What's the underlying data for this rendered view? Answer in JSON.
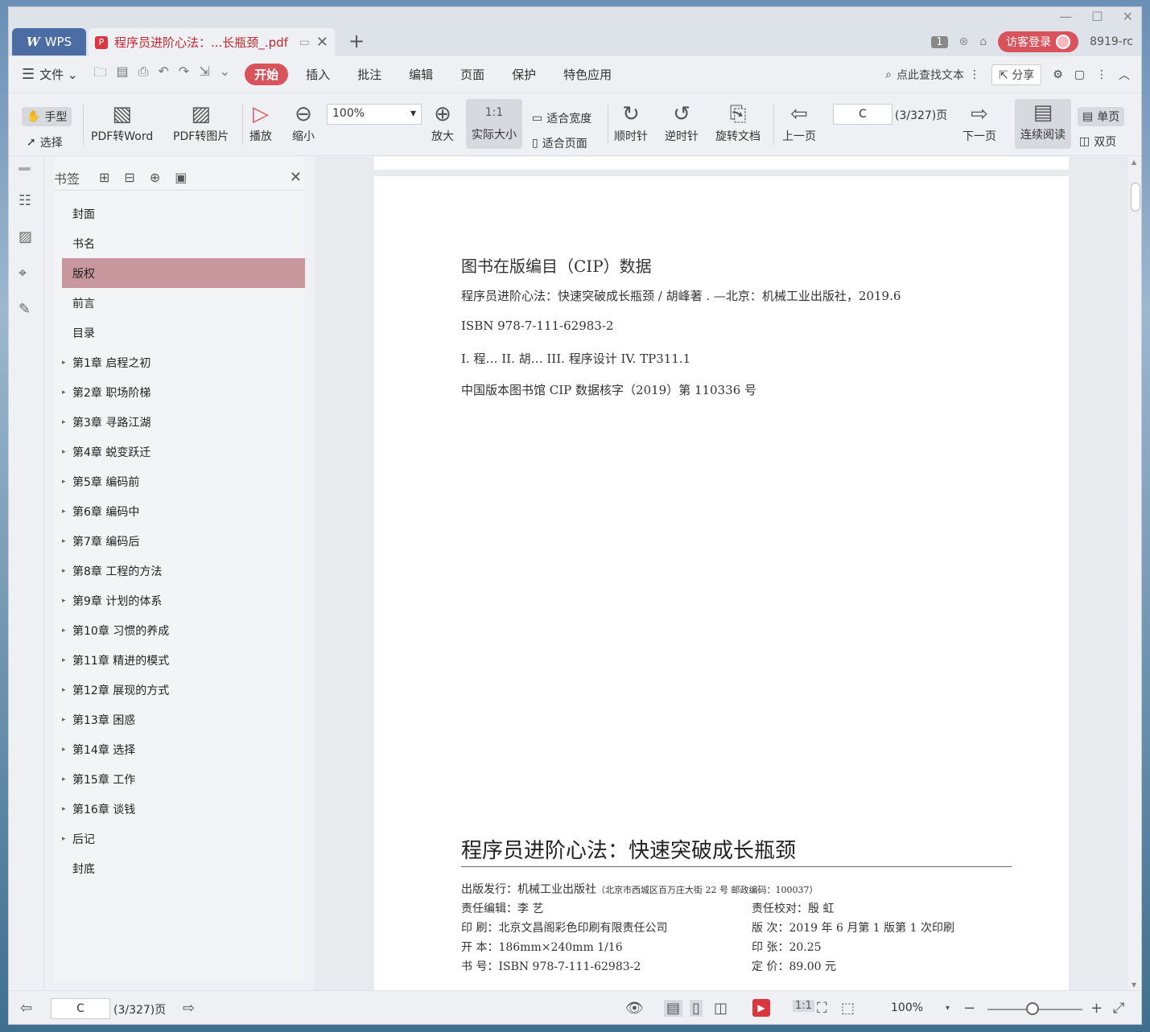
{
  "app": {
    "logo_label": "WPS",
    "doc_tab_title": "程序员进阶心法：...长瓶颈_.pdf",
    "user_button": "访客登录",
    "user_id": "8919-rc",
    "notification_count": "1"
  },
  "menubar": {
    "file": "文件",
    "tabs": [
      "开始",
      "插入",
      "批注",
      "编辑",
      "页面",
      "保护",
      "特色应用"
    ],
    "search_label": "点此查找文本",
    "share_label": "分享"
  },
  "toolbar": {
    "hand": "手型",
    "select": "选择",
    "pdf_to_word": "PDF转Word",
    "pdf_to_image": "PDF转图片",
    "play": "播放",
    "zoom_out": "缩小",
    "zoom_value": "100%",
    "zoom_in": "放大",
    "actual_size": "实际大小",
    "fit_width": "适合宽度",
    "fit_page": "适合页面",
    "rotate_cw": "顺时针",
    "rotate_ccw": "逆时针",
    "rotate_doc": "旋转文档",
    "prev_page": "上一页",
    "page_input": "C",
    "page_total": "(3/327)页",
    "next_page": "下一页",
    "continuous": "连续阅读",
    "single": "单页",
    "double": "双页"
  },
  "bookmarks": {
    "title": "书签",
    "selected_index": 2,
    "items": [
      {
        "label": "封面",
        "expandable": false
      },
      {
        "label": "书名",
        "expandable": false
      },
      {
        "label": "版权",
        "expandable": false
      },
      {
        "label": "前言",
        "expandable": false
      },
      {
        "label": "目录",
        "expandable": false
      },
      {
        "label": "第1章 启程之初",
        "expandable": true
      },
      {
        "label": "第2章 职场阶梯",
        "expandable": true
      },
      {
        "label": "第3章 寻路江湖",
        "expandable": true
      },
      {
        "label": "第4章 蜕变跃迁",
        "expandable": true
      },
      {
        "label": "第5章 编码前",
        "expandable": true
      },
      {
        "label": "第6章 编码中",
        "expandable": true
      },
      {
        "label": "第7章 编码后",
        "expandable": true
      },
      {
        "label": "第8章 工程的方法",
        "expandable": true
      },
      {
        "label": "第9章 计划的体系",
        "expandable": true
      },
      {
        "label": "第10章 习惯的养成",
        "expandable": true
      },
      {
        "label": "第11章 精进的模式",
        "expandable": true
      },
      {
        "label": "第12章 展现的方式",
        "expandable": true
      },
      {
        "label": "第13章 困惑",
        "expandable": true
      },
      {
        "label": "第14章 选择",
        "expandable": true
      },
      {
        "label": "第15章 工作",
        "expandable": true
      },
      {
        "label": "第16章 谈钱",
        "expandable": true
      },
      {
        "label": "后记",
        "expandable": true
      },
      {
        "label": "封底",
        "expandable": false
      }
    ]
  },
  "page": {
    "cip_title": "图书在版编目（CIP）数据",
    "cip_lines": [
      "程序员进阶心法：快速突破成长瓶颈 / 胡峰著 . —北京：机械工业出版社，2019.6",
      "ISBN 978-7-111-62983-2",
      "I. 程…   II. 胡…   III. 程序设计   IV. TP311.1",
      "中国版本图书馆 CIP 数据核字（2019）第 110336 号"
    ],
    "book_title": "程序员进阶心法：快速突破成长瓶颈",
    "publisher": "出版发行：机械工业出版社",
    "publisher_addr": "（北京市西城区百万庄大街 22 号   邮政编码：100037）",
    "editor": "责任编辑：李   艺",
    "proofreader": "责任校对：殷   虹",
    "printer": "印      刷：北京文昌阁彩色印刷有限责任公司",
    "edition": "版      次：2019 年 6 月第 1 版第 1 次印刷",
    "format": "开      本：186mm×240mm   1/16",
    "sheets": "印      张：20.25",
    "isbn": "书      号：ISBN 978-7-111-62983-2",
    "price": "定      价：89.00 元"
  },
  "statusbar": {
    "page_input": "C",
    "page_total": "(3/327)页",
    "zoom": "100%"
  },
  "colors": {
    "accent": "#d9535d",
    "bookmark_selected": "#c8969d",
    "wps_tab": "#4b6da3"
  }
}
